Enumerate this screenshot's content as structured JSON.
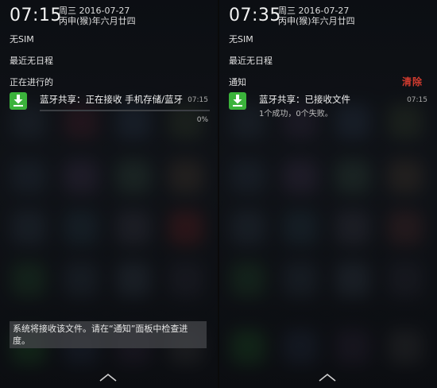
{
  "left": {
    "clock": "07:15",
    "weekday_date": "周三 2016-07-27",
    "lunar_date": "丙申(猴)年六月廿四",
    "sim_status": "无SIM",
    "schedule": "最近无日程",
    "section_label": "正在进行的",
    "notification": {
      "title": "蓝牙共享：正在接收 手机存储/蓝牙",
      "time": "07:15",
      "progress_percent": 0,
      "progress_label": "0%",
      "icon": "download-icon"
    },
    "toast": "系统将接收该文件。请在“通知”面板中检查进度。"
  },
  "right": {
    "clock": "07:35",
    "weekday_date": "周三 2016-07-27",
    "lunar_date": "丙申(猴)年六月廿四",
    "sim_status": "无SIM",
    "schedule": "最近无日程",
    "section_label": "通知",
    "clear_label": "清除",
    "notification": {
      "title": "蓝牙共享：已接收文件",
      "time": "07:15",
      "subtitle": "1个成功，0个失败。",
      "icon": "download-icon"
    }
  },
  "colors": {
    "accent_red": "#d23b2f",
    "icon_green": "#3bb33b",
    "progress_blue": "#5aa0e0"
  }
}
